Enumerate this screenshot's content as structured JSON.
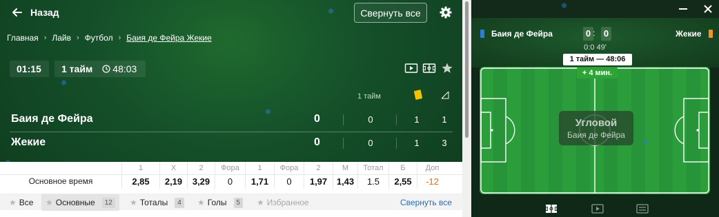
{
  "header": {
    "back_label": "Назад",
    "collapse_all_label": "Свернуть все"
  },
  "breadcrumbs": [
    "Главная",
    "Лайв",
    "Футбол",
    "Баия де Фейра Жекие"
  ],
  "match": {
    "elapsed": "01:15",
    "period": "1 тайм",
    "clock": "48:03",
    "column_header": "1 тайм",
    "teams": [
      {
        "name": "Баия де Фейра",
        "score": "0",
        "half": "0",
        "yellow": "1",
        "corners": "1"
      },
      {
        "name": "Жекие",
        "score": "0",
        "half": "0",
        "yellow": "1",
        "corners": "3"
      }
    ]
  },
  "odds": {
    "row_label": "Основное время",
    "headers": [
      "1",
      "X",
      "2",
      "Фора",
      "1",
      "Фора",
      "2",
      "М",
      "Тотал",
      "Б",
      "Доп"
    ],
    "values": [
      "2,85",
      "2,19",
      "3,29",
      "0",
      "1,71",
      "0",
      "1,97",
      "1,43",
      "1.5",
      "2,55",
      "-12"
    ]
  },
  "filters": {
    "items": [
      {
        "label": "Все"
      },
      {
        "label": "Основные",
        "count": "12"
      },
      {
        "label": "Тоталы",
        "count": "4"
      },
      {
        "label": "Голы",
        "count": "5"
      },
      {
        "label": "Избранное"
      }
    ],
    "collapse_label": "Свернуть все"
  },
  "tracker": {
    "home": {
      "name": "Баия де Фейра",
      "score": "0",
      "color": "#2b7ed6"
    },
    "away": {
      "name": "Жекие",
      "score": "0",
      "color": "#f0912b"
    },
    "colon": ":",
    "sub_clock": "0:0 49'",
    "period_clock": "1 тайм — 48:06",
    "added_time": "+ 4 мин.",
    "event_title": "Угловой",
    "event_team": "Баия де Фейра"
  },
  "colors": {
    "pitch_green": "#2a9a3a",
    "accent_blue": "#1a6fc4",
    "yellow_card": "#f2c200",
    "negative": "#e06a1a"
  },
  "icons": [
    "arrow-left-icon",
    "gear-icon",
    "clock-icon",
    "video-icon",
    "field-icon",
    "star-icon",
    "yellow-card-icon",
    "corner-flag-icon",
    "minimize-icon",
    "close-icon",
    "snowflake-icon",
    "list-icon"
  ]
}
